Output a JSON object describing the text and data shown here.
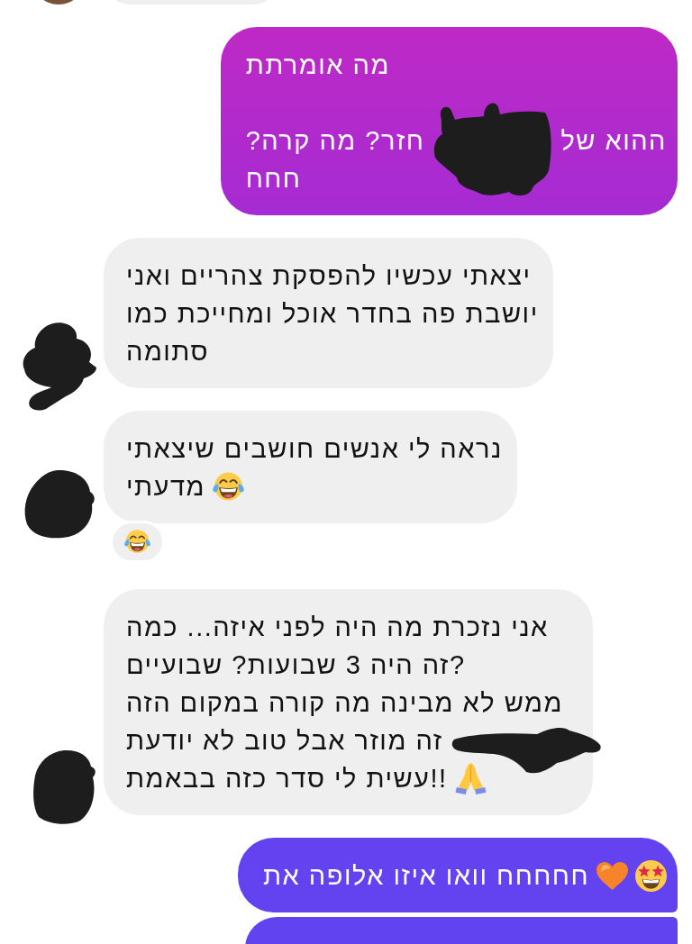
{
  "conversation": {
    "groups": [
      {
        "kind": "incoming",
        "avatar": {
          "kind": "photo"
        },
        "messages": [
          {
            "kind": "clipped"
          }
        ]
      },
      {
        "kind": "outgoing",
        "messages": [
          {
            "kind": "text",
            "paragraphs": [
              {
                "lines": [
                  {
                    "parts": [
                      {
                        "kind": "text",
                        "text": "מה אומרתת"
                      }
                    ]
                  }
                ]
              },
              {
                "lines": [
                  {
                    "parts": [
                      {
                        "kind": "text",
                        "text": "ההוא של"
                      },
                      {
                        "kind": "redaction"
                      },
                      {
                        "kind": "text",
                        "text": "חזר? מה קרה?"
                      }
                    ]
                  },
                  {
                    "parts": [
                      {
                        "kind": "text",
                        "text": "חחח"
                      }
                    ]
                  }
                ]
              }
            ]
          }
        ]
      },
      {
        "kind": "incoming",
        "avatar": {
          "kind": "scribbled"
        },
        "messages": [
          {
            "kind": "text",
            "paragraphs": [
              {
                "lines": [
                  {
                    "parts": [
                      {
                        "kind": "text",
                        "text": "יצאתי עכשיו להפסקת צהריים ואני"
                      }
                    ]
                  },
                  {
                    "parts": [
                      {
                        "kind": "text",
                        "text": "יושבת פה בחדר אוכל ומחייכת כמו"
                      }
                    ]
                  },
                  {
                    "parts": [
                      {
                        "kind": "text",
                        "text": "סתומה"
                      }
                    ]
                  }
                ]
              }
            ]
          }
        ]
      },
      {
        "kind": "incoming",
        "avatar": {
          "kind": "scribbled"
        },
        "messages": [
          {
            "kind": "text",
            "paragraphs": [
              {
                "lines": [
                  {
                    "parts": [
                      {
                        "kind": "text",
                        "text": "נראה לי אנשים חושבים שיצאתי"
                      }
                    ]
                  },
                  {
                    "parts": [
                      {
                        "kind": "laughing"
                      },
                      {
                        "kind": "text",
                        "text": "מדעתי"
                      }
                    ]
                  }
                ]
              }
            ],
            "reactions": [
              {
                "kind": "laughing"
              }
            ]
          }
        ]
      },
      {
        "kind": "incoming",
        "avatar": {
          "kind": "scribbled"
        },
        "messages": [
          {
            "kind": "text",
            "paragraphs": [
              {
                "lines": [
                  {
                    "parts": [
                      {
                        "kind": "text",
                        "text": "אני נזכרת מה היה לפני איזה... כמה"
                      }
                    ]
                  },
                  {
                    "parts": [
                      {
                        "kind": "text",
                        "text": "?זה היה 3 שבועות? שבועיים"
                      }
                    ]
                  },
                  {
                    "parts": [
                      {
                        "kind": "text",
                        "text": "ממש לא מבינה מה קורה במקום הזה"
                      }
                    ]
                  },
                  {
                    "parts": [
                      {
                        "kind": "redaction"
                      },
                      {
                        "kind": "text",
                        "text": "זה מוזר אבל טוב לא יודעת"
                      }
                    ]
                  },
                  {
                    "parts": [
                      {
                        "kind": "praying"
                      },
                      {
                        "kind": "text",
                        "text": "!!עשית לי סדר כזה בבאמת"
                      }
                    ]
                  }
                ]
              }
            ]
          }
        ]
      },
      {
        "kind": "outgoing",
        "messages": [
          {
            "kind": "text",
            "paragraphs": [
              {
                "lines": [
                  {
                    "parts": [
                      {
                        "kind": "starstruck"
                      },
                      {
                        "kind": "heart"
                      },
                      {
                        "kind": "text",
                        "text": "חחחחח וואו איזו אלופה את"
                      }
                    ]
                  }
                ]
              }
            ]
          },
          {
            "kind": "clipped"
          }
        ]
      }
    ]
  }
}
